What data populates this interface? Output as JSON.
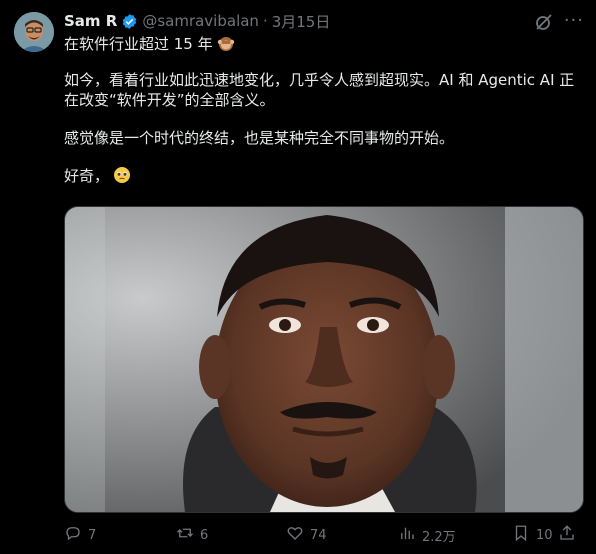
{
  "author": {
    "name": "Sam R",
    "handle": "@samravibalan",
    "separator": "·",
    "date": "3月15日"
  },
  "tweet": {
    "line1": "在软件行业超过 15 年",
    "para1": "如今，看着行业如此迅速地变化，几乎令人感到超现实。AI 和 Agentic AI 正在改变“软件开发”的全部含义。",
    "para2": "感觉像是一个时代的终结，也是某种完全不同事物的开始。",
    "para3": "好奇，"
  },
  "actions": {
    "replies": "7",
    "reposts": "6",
    "likes": "74",
    "views": "2.2万",
    "bookmarks": "10"
  },
  "icons": [
    "verified-icon",
    "grok-icon",
    "more-icon",
    "monkey-emoji-icon",
    "pleading-emoji-icon",
    "reply-icon",
    "repost-icon",
    "like-icon",
    "views-icon",
    "bookmark-icon",
    "share-icon"
  ],
  "colors": {
    "background": "#000000",
    "text": "#e7e9ea",
    "muted": "#71767b",
    "verified": "#1d9bf0"
  }
}
